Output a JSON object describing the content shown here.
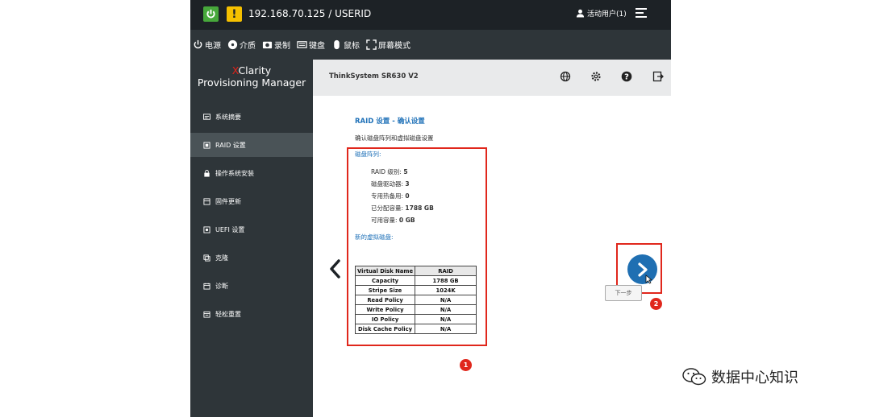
{
  "topbar": {
    "ip_user": "192.168.70.125 / USERID",
    "active_user": "活动用户(1)",
    "warning_symbol": "!"
  },
  "toolbar": {
    "items": [
      "电源",
      "介质",
      "录制",
      "键盘",
      "鼠标",
      "屏幕模式"
    ]
  },
  "sidebar": {
    "brand_x": "X",
    "brand_rest": "Clarity",
    "brand_line2": "Provisioning Manager",
    "items": [
      {
        "label": "系统摘要",
        "icon": "summary-icon"
      },
      {
        "label": "RAID 设置",
        "icon": "raid-icon"
      },
      {
        "label": "操作系统安装",
        "icon": "os-install-icon"
      },
      {
        "label": "固件更新",
        "icon": "firmware-icon"
      },
      {
        "label": "UEFI 设置",
        "icon": "uefi-icon"
      },
      {
        "label": "克隆",
        "icon": "clone-icon"
      },
      {
        "label": "诊断",
        "icon": "diagnostics-icon"
      },
      {
        "label": "轻松重置",
        "icon": "reset-icon"
      }
    ],
    "active_index": 1
  },
  "header": {
    "model": "ThinkSystem SR630 V2"
  },
  "main": {
    "title": "RAID 设置 - 确认设置",
    "subtitle": "确认磁盘阵列和虚拟磁盘设置",
    "array_label": "磁盘阵列:",
    "array": [
      {
        "key": "RAID 级别:",
        "value": "5"
      },
      {
        "key": "磁盘驱动器:",
        "value": "3"
      },
      {
        "key": "专用热备用:",
        "value": "0"
      },
      {
        "key": "已分配容量:",
        "value": "1788 GB"
      },
      {
        "key": "可用容量:",
        "value": "0 GB"
      }
    ],
    "vdisk_label": "新的虚拟磁盘:",
    "table": {
      "headers": [
        "Virtual Disk Name",
        "RAID"
      ],
      "rows": [
        [
          "Capacity",
          "1788 GB"
        ],
        [
          "Stripe Size",
          "1024K"
        ],
        [
          "Read Policy",
          "N/A"
        ],
        [
          "Write Policy",
          "N/A"
        ],
        [
          "IO Policy",
          "N/A"
        ],
        [
          "Disk Cache Policy",
          "N/A"
        ]
      ]
    },
    "next_label": "下一步",
    "badges": [
      "1",
      "2"
    ]
  },
  "watermark": "数据中心知识",
  "colors": {
    "accent": "#1f71b8",
    "annotation_red": "#e0271c",
    "power_green": "#47a83b",
    "warning_yellow": "#f5c000"
  }
}
